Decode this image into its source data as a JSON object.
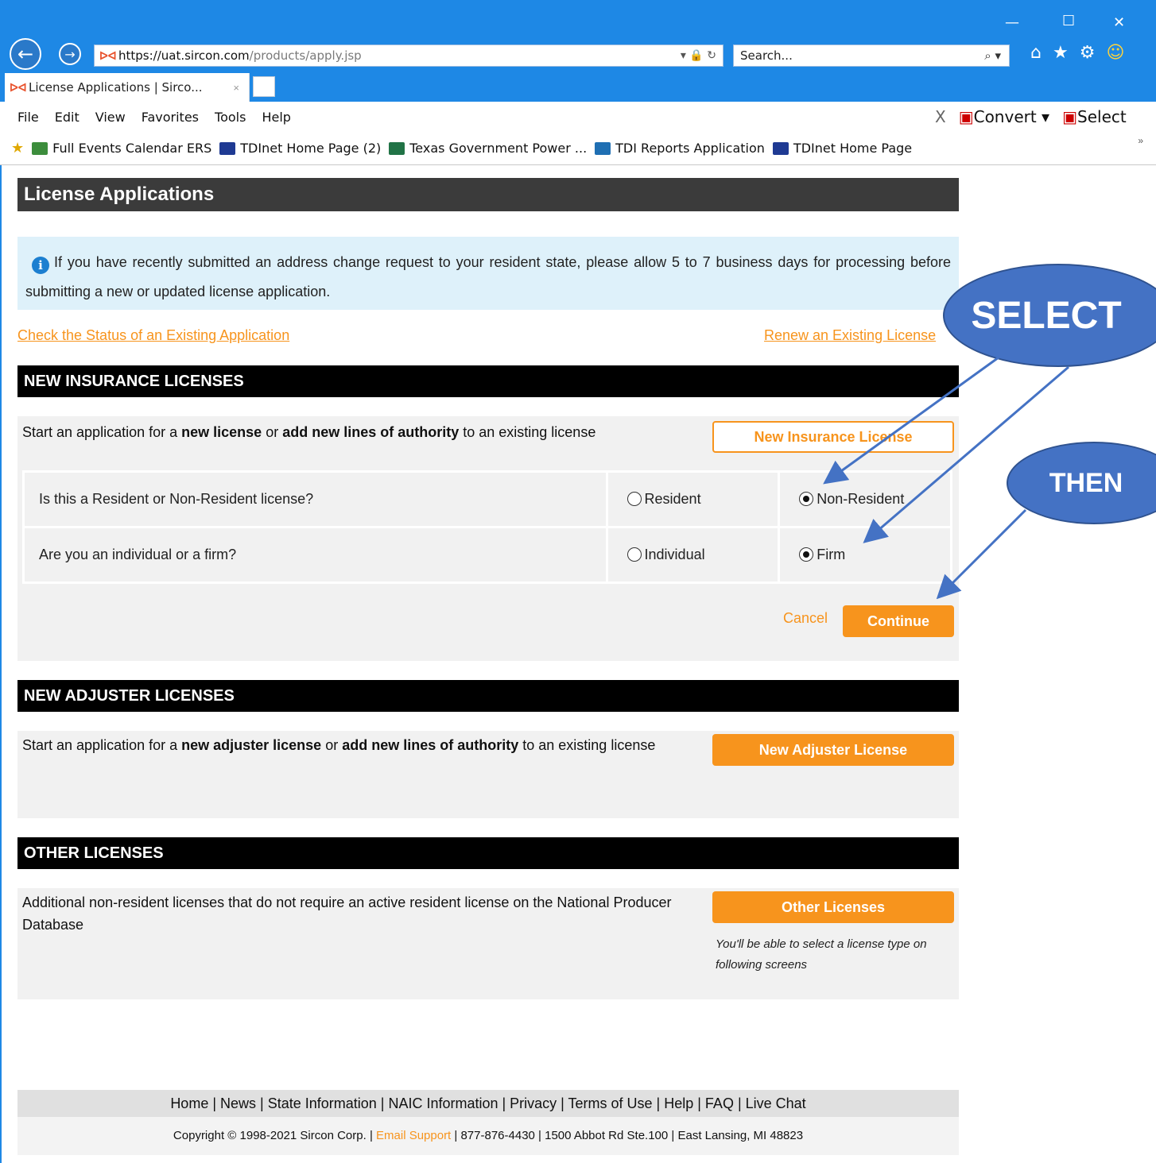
{
  "browser": {
    "url_host": "https://uat.sircon.com",
    "url_path": "/products/apply.jsp",
    "url_tools": "▾ 🔒 ↻",
    "search_placeholder": "Search...",
    "tab_title": "License Applications | Sirco...",
    "tab_close": "×",
    "logo_text": "ᐅᐊ",
    "menu": [
      "File",
      "Edit",
      "View",
      "Favorites",
      "Tools",
      "Help"
    ],
    "menu_right": {
      "close": "X",
      "convert": "Convert",
      "select": "Select"
    },
    "favorites": [
      {
        "label": "Full Events Calendar  ERS",
        "color": "#3c8d3c"
      },
      {
        "label": "TDInet Home Page (2)",
        "color": "#1f3a93"
      },
      {
        "label": "Texas Government Power ...",
        "color": "#217346"
      },
      {
        "label": "TDI Reports Application",
        "color": "#1f6fb3"
      },
      {
        "label": "TDInet Home Page",
        "color": "#1f3a93"
      }
    ]
  },
  "page": {
    "title": "License Applications",
    "info": "If you have recently submitted an address change request to your resident state, please allow 5 to 7 business days for processing before submitting a new or updated license application.",
    "link_status": "Check the Status of an Existing Application",
    "link_renew": "Renew an Existing License",
    "insurance": {
      "header": "NEW INSURANCE LICENSES",
      "text_a": "Start an application for a ",
      "text_b": "new license",
      "text_c": " or ",
      "text_d": "add new lines of authority",
      "text_e": " to an existing license",
      "button": "New Insurance License",
      "questions": [
        {
          "q": "Is this a Resident or Non-Resident license?",
          "opt1": "Resident",
          "opt2": "Non-Resident",
          "selected": "opt2"
        },
        {
          "q": "Are you an individual or a firm?",
          "opt1": "Individual",
          "opt2": "Firm",
          "selected": "opt2"
        }
      ],
      "cancel": "Cancel",
      "continue": "Continue"
    },
    "adjuster": {
      "header": "NEW ADJUSTER LICENSES",
      "text_a": "Start an application for a ",
      "text_b": "new adjuster license",
      "text_c": " or ",
      "text_d": "add new lines of authority",
      "text_e": " to an existing license",
      "button": "New Adjuster License"
    },
    "other": {
      "header": "OTHER LICENSES",
      "text": "Additional non-resident licenses that do not require an active resident license on the National Producer Database",
      "button": "Other Licenses",
      "note": "You'll be able to select a license type on following screens"
    },
    "footer_links": "Home | News | State Information | NAIC Information | Privacy | Terms of Use | Help | FAQ | Live Chat",
    "copyright_a": "Copyright © 1998-2021 Sircon Corp. | ",
    "copyright_email": "Email Support",
    "copyright_b": " | 877-876-4430 | 1500 Abbot Rd Ste.100 | East Lansing, MI 48823"
  },
  "annotations": {
    "select": "SELECT",
    "then": "THEN"
  },
  "colors": {
    "accent": "#f7941d",
    "chrome": "#1e88e5",
    "bubble": "#4472c4"
  }
}
